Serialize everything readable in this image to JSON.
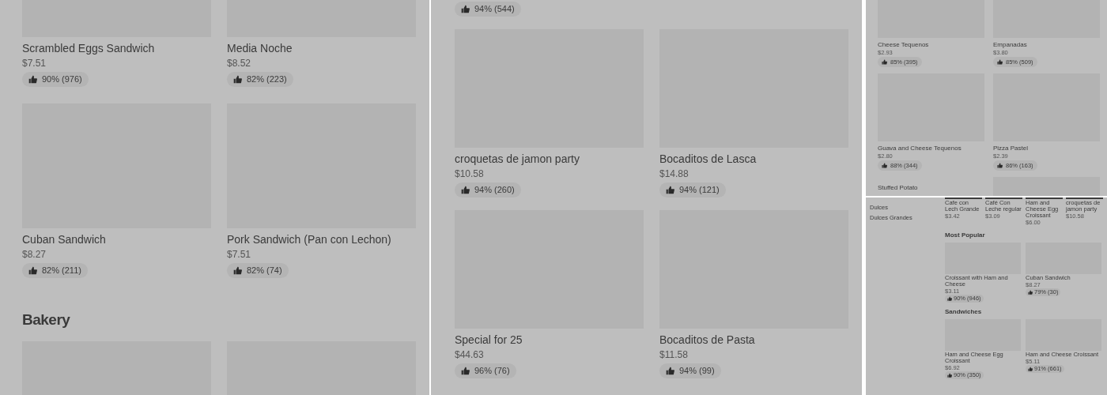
{
  "panels": [
    {
      "blocks": [
        {
          "kind": "cards",
          "items": [
            {
              "kind": "product",
              "name": "Scrambled Eggs Sandwich",
              "price": "$7.51",
              "rating": "90% (976)"
            },
            {
              "kind": "product",
              "name": "Media Noche",
              "price": "$8.52",
              "rating": "82% (223)"
            },
            {
              "kind": "product",
              "name": "Cuban Sandwich",
              "price": "$8.27",
              "rating": "82% (211)"
            },
            {
              "kind": "product",
              "name": "Pork Sandwich (Pan con Lechon)",
              "price": "$7.51",
              "rating": "82% (74)"
            }
          ]
        },
        {
          "kind": "heading",
          "text": "Bakery"
        },
        {
          "kind": "cards",
          "items": [
            {
              "kind": "image_only"
            },
            {
              "kind": "image_only"
            }
          ]
        }
      ]
    },
    {
      "blocks": [
        {
          "kind": "cards",
          "items": [
            {
              "kind": "rating_only",
              "rating": "94% (544)"
            },
            {
              "kind": "offscreen"
            },
            {
              "kind": "product",
              "name": "croquetas de jamon party",
              "price": "$10.58",
              "rating": "94% (260)"
            },
            {
              "kind": "product",
              "name": "Bocaditos de Lasca",
              "price": "$14.88",
              "rating": "94% (121)"
            },
            {
              "kind": "product",
              "name": "Special for 25",
              "price": "$44.63",
              "rating": "96% (76)"
            },
            {
              "kind": "product",
              "name": "Bocaditos de Pasta",
              "price": "$11.58",
              "rating": "94% (99)"
            }
          ]
        }
      ]
    },
    {
      "blocks": [
        {
          "kind": "cards",
          "items": [
            {
              "kind": "product",
              "name": "Cheese Tequenos",
              "price": "$2.93",
              "rating": "85% (395)"
            },
            {
              "kind": "product",
              "name": "Empanadas",
              "price": "$3.80",
              "rating": "85% (509)"
            },
            {
              "kind": "product",
              "name": "Guava and Cheese Tequenos",
              "price": "$2.80",
              "rating": "88% (344)"
            },
            {
              "kind": "product",
              "name": "Pizza Pastel",
              "price": "$2.39",
              "rating": "86% (163)"
            },
            {
              "kind": "text_only",
              "name": "Stuffed Potato"
            },
            {
              "kind": "image_only"
            }
          ]
        }
      ]
    },
    {
      "sidebar": [
        "Dulces",
        "Dulces Grandes"
      ],
      "blocks": [
        {
          "kind": "carousel",
          "items": [
            {
              "name": "Cafe con Lech Grande",
              "price": "$3.42"
            },
            {
              "name": "Café Con Leche regular",
              "price": "$3.09"
            },
            {
              "name": "Ham and Cheese Egg Croissant",
              "price": "$6.00"
            },
            {
              "name": "croquetas de jamon party",
              "price": "$10.58"
            }
          ]
        },
        {
          "kind": "heading",
          "text": "Most Popular"
        },
        {
          "kind": "cards",
          "items": [
            {
              "kind": "product",
              "name": "Croissant with Ham and Cheese",
              "price": "$3.11",
              "rating": "90% (946)"
            },
            {
              "kind": "product",
              "name": "Cuban Sandwich",
              "price": "$8.27",
              "rating": "79% (30)"
            }
          ]
        },
        {
          "kind": "heading",
          "text": "Sandwiches"
        },
        {
          "kind": "cards",
          "items": [
            {
              "kind": "product",
              "name": "Ham and Cheese Egg Croissant",
              "price": "$6.92",
              "rating": "90% (350)"
            },
            {
              "kind": "product",
              "name": "Ham and Cheese Croissant",
              "price": "$5.11",
              "rating": "91% (661)"
            }
          ]
        }
      ]
    }
  ]
}
